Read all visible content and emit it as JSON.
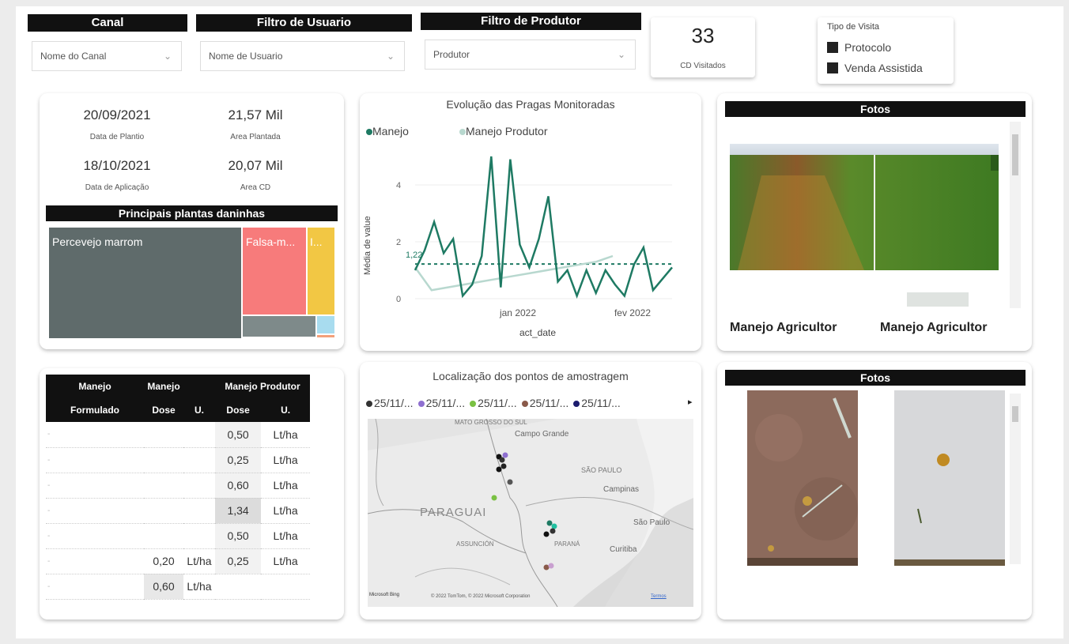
{
  "filters": {
    "canal": {
      "title": "Canal",
      "value": "Nome do Canal"
    },
    "usuario": {
      "title": "Filtro de Usuario",
      "value": "Nome de Usuario"
    },
    "produtor": {
      "title": "Filtro de Produtor",
      "value": "Produtor"
    }
  },
  "cd_card": {
    "value": "33",
    "label": "CD Visitados"
  },
  "tipo_visita": {
    "title": "Tipo de Visita",
    "options": [
      "Protocolo",
      "Venda Assistida"
    ]
  },
  "kpis": {
    "data_plantio": {
      "value": "20/09/2021",
      "label": "Data de Plantio"
    },
    "area_plantada": {
      "value": "21,57 Mil",
      "label": "Area Plantada"
    },
    "data_aplicacao": {
      "value": "18/10/2021",
      "label": "Data de Aplicação"
    },
    "area_cd": {
      "value": "20,07 Mil",
      "label": "Area CD"
    }
  },
  "treemap": {
    "title": "Principais plantas daninhas",
    "items": [
      {
        "label": "Percevejo marrom",
        "color": "#5f6b6b"
      },
      {
        "label": "Falsa-m...",
        "color": "#f77b7b"
      },
      {
        "label": "I...",
        "color": "#f2c744"
      },
      {
        "label": "",
        "color": "#7e8a8a"
      },
      {
        "label": "",
        "color": "#a8dcef"
      },
      {
        "label": "",
        "color": "#f3a07a"
      }
    ]
  },
  "table": {
    "header_row1": [
      "Manejo",
      "Manejo",
      "Manejo Produtor"
    ],
    "header_row2": [
      "Formulado",
      "Dose",
      "U.",
      "Dose",
      "U."
    ],
    "rows": [
      [
        "-",
        "",
        "",
        "0,50",
        "Lt/ha"
      ],
      [
        "-",
        "",
        "",
        "0,25",
        "Lt/ha"
      ],
      [
        "-",
        "",
        "",
        "0,60",
        "Lt/ha"
      ],
      [
        "-",
        "",
        "",
        "1,34",
        "Lt/ha"
      ],
      [
        "-",
        "",
        "",
        "0,50",
        "Lt/ha"
      ],
      [
        "-",
        "0,20",
        "Lt/ha",
        "0,25",
        "Lt/ha"
      ],
      [
        "-",
        "0,60",
        "Lt/ha",
        "",
        ""
      ]
    ]
  },
  "line_chart": {
    "title": "Evolução das Pragas Monitoradas",
    "xlabel": "act_date",
    "ylabel": "Média de value",
    "legend": [
      {
        "name": "Manejo",
        "color": "#1e7a63"
      },
      {
        "name": "Manejo Produtor",
        "color": "#b8d8cf"
      }
    ],
    "avg_label": "1,22"
  },
  "chart_data": {
    "type": "line",
    "title": "Evolução das Pragas Monitoradas",
    "xlabel": "act_date",
    "ylabel": "Média de value",
    "x_ticks": [
      "jan 2022",
      "fev 2022"
    ],
    "y_ticks": [
      0,
      2,
      4
    ],
    "ylim": [
      0,
      5
    ],
    "average_line": 1.22,
    "series": [
      {
        "name": "Manejo",
        "color": "#1e7a63",
        "values": [
          1.0,
          1.7,
          2.7,
          1.6,
          2.1,
          0.1,
          0.5,
          1.5,
          5.0,
          0.4,
          4.9,
          1.9,
          1.1,
          2.1,
          3.6,
          0.6,
          1.0,
          0.1,
          1.0,
          0.2,
          1.0,
          0.5,
          0.1,
          1.2,
          1.8,
          0.3,
          0.7,
          1.1
        ]
      },
      {
        "name": "Manejo Produtor",
        "color": "#b8d8cf",
        "values": [
          1.1,
          0.3,
          0.4,
          0.5,
          0.6,
          0.7,
          0.8,
          0.9,
          1.0,
          1.1,
          1.2,
          1.3,
          1.5
        ]
      }
    ]
  },
  "map": {
    "title": "Localização dos pontos de amostragem",
    "legend": [
      {
        "label": "25/11/...",
        "color": "#333333"
      },
      {
        "label": "25/11/...",
        "color": "#8e6fd0"
      },
      {
        "label": "25/11/...",
        "color": "#7ac143"
      },
      {
        "label": "25/11/...",
        "color": "#8a5a4a"
      },
      {
        "label": "25/11/...",
        "color": "#1c1c6e"
      }
    ],
    "labels": {
      "ms": "MATO GROSSO DO SUL",
      "campo_grande": "Campo Grande",
      "sao_paulo_state": "SÃO PAULO",
      "campinas": "Campinas",
      "sao_paulo": "São Paulo",
      "paraguai": "PARAGUAI",
      "assuncao": "ASSUNCIÓN",
      "parana": "PARANÁ",
      "curitiba": "Curitiba"
    },
    "attribution": "© 2022 TomTom, © 2022 Microsoft Corporation",
    "bing": "Microsoft Bing",
    "terms": "Termos"
  },
  "photos_top": {
    "title": "Fotos",
    "captions": [
      "Manejo Agricultor",
      "Manejo Agricultor"
    ]
  },
  "photos_bottom": {
    "title": "Fotos"
  }
}
